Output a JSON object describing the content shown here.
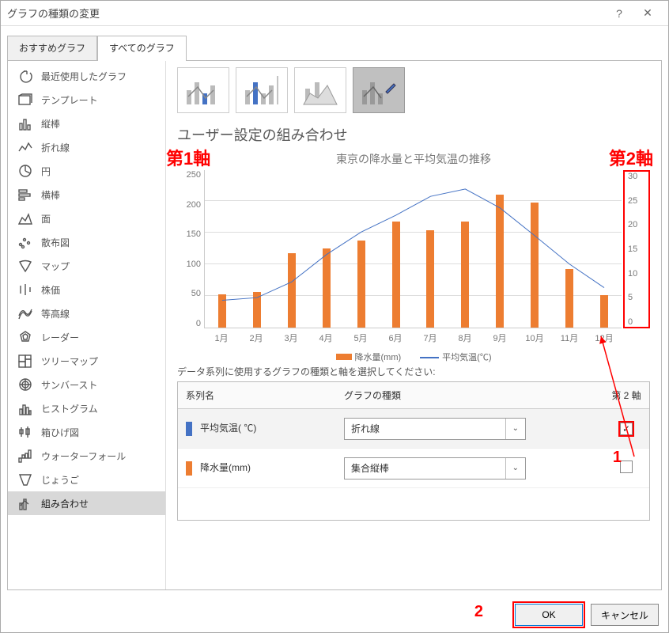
{
  "dialog": {
    "title": "グラフの種類の変更",
    "help": "?",
    "close": "✕"
  },
  "tabs": {
    "recommended": "おすすめグラフ",
    "all": "すべてのグラフ"
  },
  "sidebar": {
    "items": [
      "最近使用したグラフ",
      "テンプレート",
      "縦棒",
      "折れ線",
      "円",
      "横棒",
      "面",
      "散布図",
      "マップ",
      "株価",
      "等高線",
      "レーダー",
      "ツリーマップ",
      "サンバースト",
      "ヒストグラム",
      "箱ひげ図",
      "ウォーターフォール",
      "じょうご",
      "組み合わせ"
    ]
  },
  "preview": {
    "heading": "ユーザー設定の組み合わせ",
    "title": "東京の降水量と平均気温の推移",
    "legend1": "降水量(mm)",
    "legend2": "平均気温(℃)"
  },
  "annotations": {
    "axis1": "第1軸",
    "axis2": "第2軸",
    "callout1": "1",
    "callout2": "2"
  },
  "seriesPanel": {
    "label": "データ系列に使用するグラフの種類と軸を選択してください:",
    "headName": "系列名",
    "headType": "グラフの種類",
    "headAxis2": "第 2 軸",
    "rows": [
      {
        "name": "平均気温( ℃)",
        "type": "折れ線",
        "axis2": true
      },
      {
        "name": "降水量(mm)",
        "type": "集合縦棒",
        "axis2": false
      }
    ]
  },
  "buttons": {
    "ok": "OK",
    "cancel": "キャンセル"
  },
  "chart_data": {
    "type": "combo",
    "title": "東京の降水量と平均気温の推移",
    "categories": [
      "1月",
      "2月",
      "3月",
      "4月",
      "5月",
      "6月",
      "7月",
      "8月",
      "9月",
      "10月",
      "11月",
      "12月"
    ],
    "series": [
      {
        "name": "降水量(mm)",
        "type": "bar",
        "axis": "primary",
        "values": [
          52,
          56,
          118,
          125,
          138,
          168,
          154,
          168,
          210,
          198,
          93,
          51
        ]
      },
      {
        "name": "平均気温(℃)",
        "type": "line",
        "axis": "secondary",
        "values": [
          5.2,
          5.7,
          8.7,
          13.9,
          18.2,
          21.4,
          25.0,
          26.4,
          22.8,
          17.5,
          12.1,
          7.6
        ]
      }
    ],
    "ylim": [
      0,
      250
    ],
    "y2lim": [
      0,
      30
    ],
    "yticks": [
      0,
      50,
      100,
      150,
      200,
      250
    ],
    "y2ticks": [
      0,
      5,
      10,
      15,
      20,
      25,
      30
    ]
  }
}
